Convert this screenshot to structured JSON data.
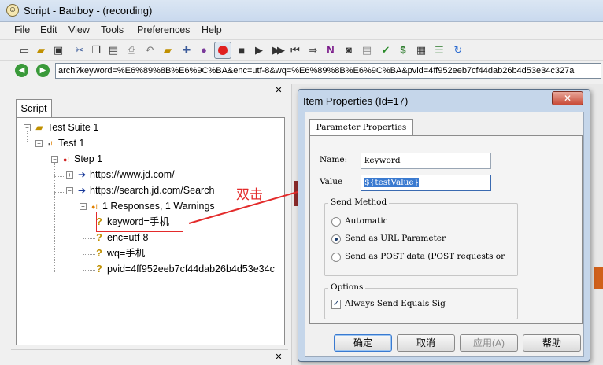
{
  "window": {
    "title": "Script - Badboy - (recording)"
  },
  "menu": [
    "File",
    "Edit",
    "View",
    "Tools",
    "Preferences",
    "Help"
  ],
  "address": {
    "url": "arch?keyword=%E6%89%8B%E6%9C%BA&enc=utf-8&wq=%E6%89%8B%E6%9C%BA&pvid=4ff952eeb7cf44dab26b4d53e34c327a"
  },
  "left_panel": {
    "tab": "Script",
    "tree": [
      {
        "label": "Test Suite 1"
      },
      {
        "label": "Test 1"
      },
      {
        "label": "Step 1"
      },
      {
        "label": "https://www.jd.com/"
      },
      {
        "label": "https://search.jd.com/Search"
      },
      {
        "label": "1 Responses, 1 Warnings"
      },
      {
        "label": "keyword=手机"
      },
      {
        "label": "enc=utf-8"
      },
      {
        "label": "wq=手机"
      },
      {
        "label": "pvid=4ff952eeb7cf44dab26b4d53e34c"
      }
    ]
  },
  "annotation": {
    "text": "双击",
    "color": "#e32a2a"
  },
  "dialog": {
    "title": "Item Properties (Id=17)",
    "tab": "Parameter Properties",
    "name_label": "Name:",
    "name_value": "keyword",
    "value_label": "Value",
    "value_value": "${testValue}",
    "send_method": {
      "title": "Send Method",
      "options": [
        "Automatic",
        "Send as URL Parameter",
        "Send as POST data (POST requests or"
      ],
      "selected": 1
    },
    "options_group": {
      "title": "Options",
      "checkbox": "Always Send Equals Sig",
      "checked": true
    },
    "buttons": [
      "确定",
      "取消",
      "应用(A)",
      "帮助"
    ]
  },
  "icons": [
    "new-icon",
    "open-icon",
    "save-icon",
    "cut-icon",
    "copy-icon",
    "paste-icon",
    "print-icon",
    "undo-icon",
    "add-step-icon",
    "add-item-icon",
    "record-icon",
    "stop-icon",
    "play-icon",
    "play-all-icon",
    "step-back-icon",
    "step-icon",
    "n-icon",
    "camera-icon",
    "page-icon",
    "check-icon",
    "dollar-icon",
    "grid-icon",
    "chart-icon",
    "refresh-icon"
  ]
}
